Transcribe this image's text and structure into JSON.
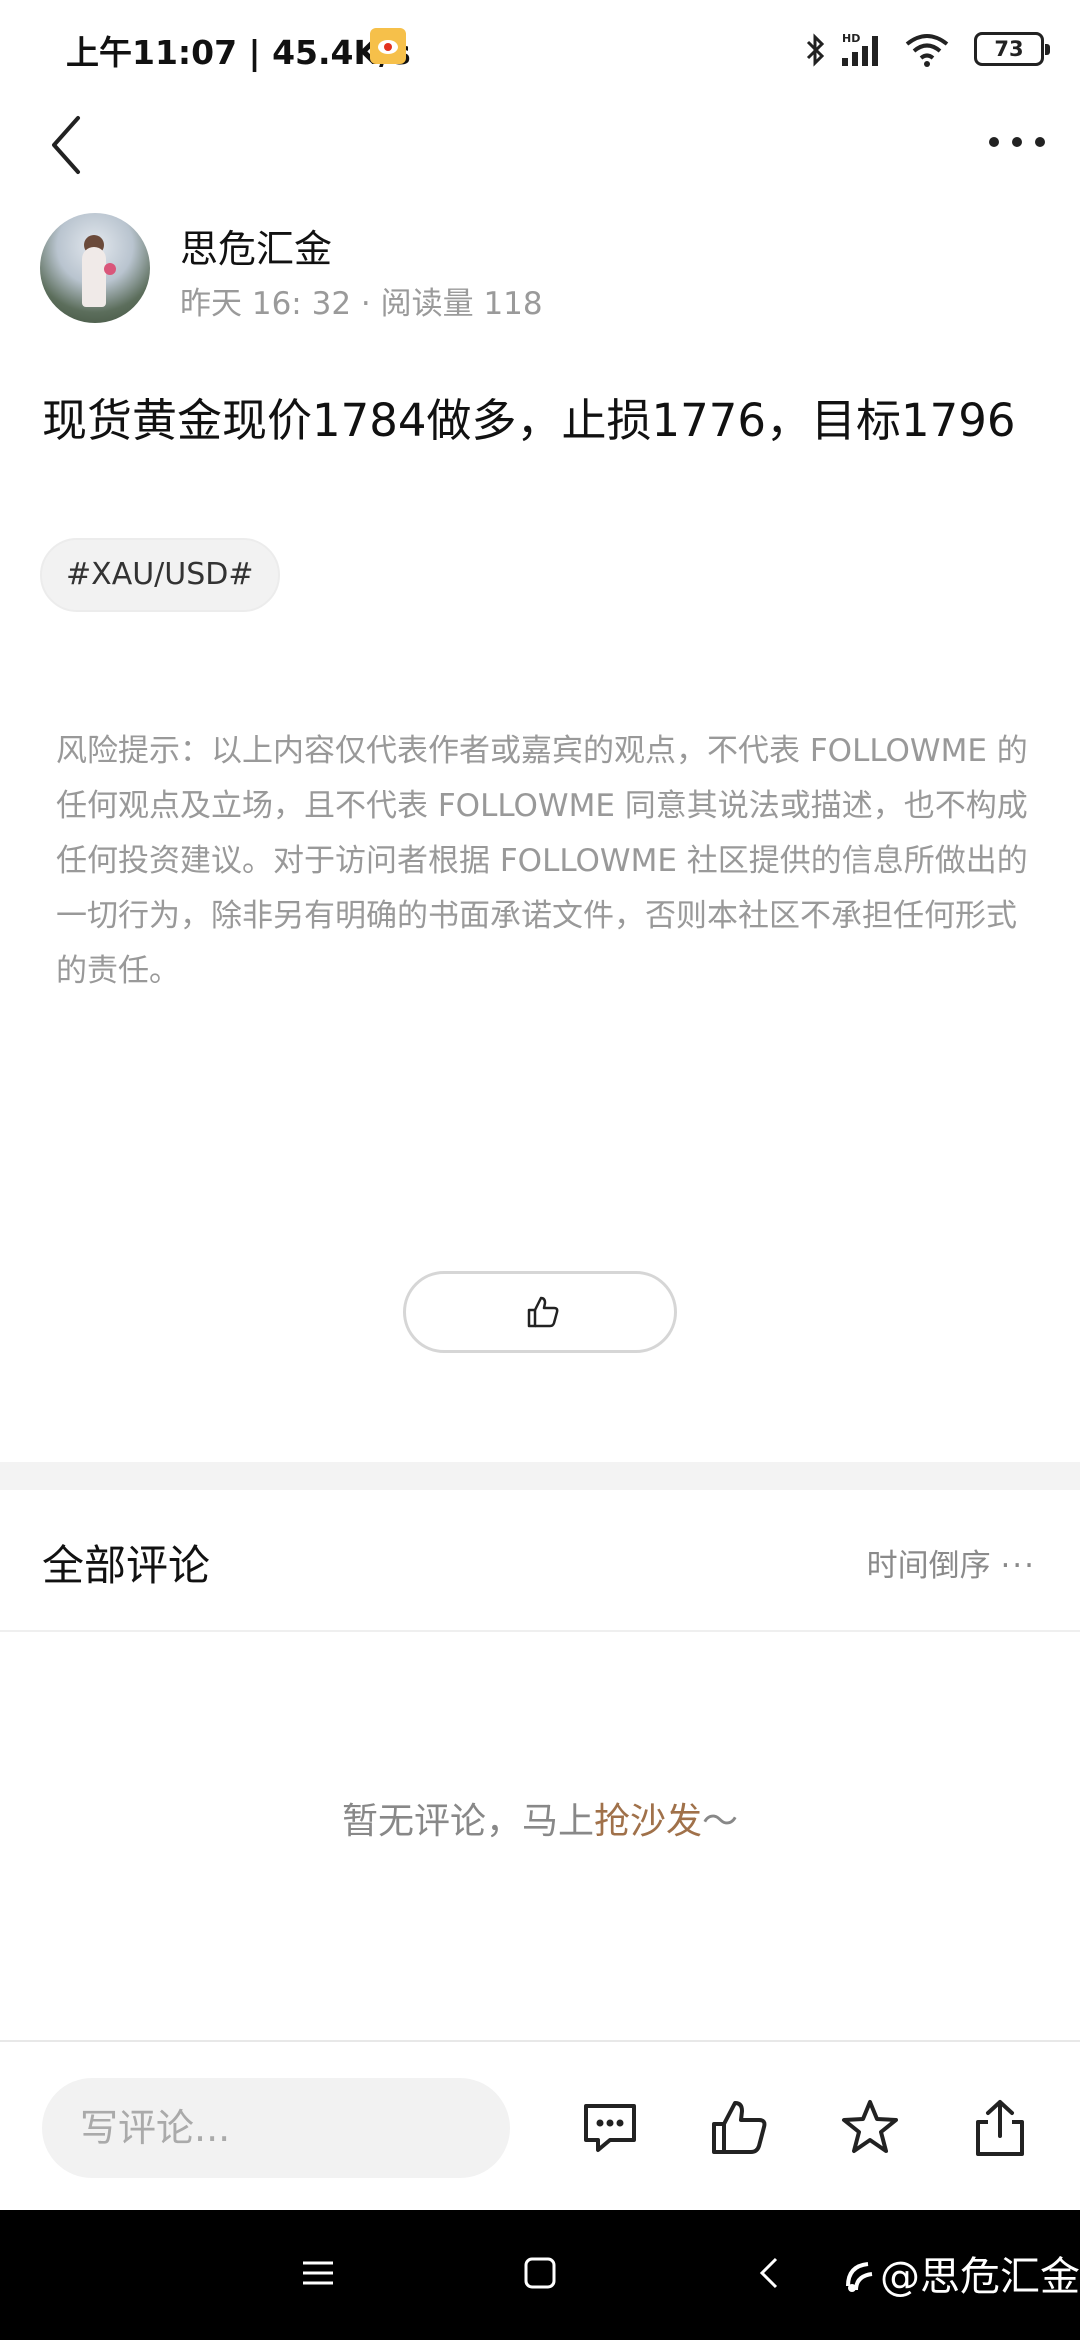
{
  "status_bar": {
    "time_speed": "上午11:07 | 45.4K/s",
    "battery": "73"
  },
  "nav": {
    "back_icon": "chevron-left-icon",
    "more_icon": "more-horizontal-icon"
  },
  "author": {
    "name": "思危汇金",
    "meta": "昨天 16: 32 · 阅读量 118"
  },
  "post": {
    "title": "现货黄金现价1784做多，止损1776，目标1796",
    "topic_tag": "#XAU/USD#",
    "disclaimer": "风险提示：以上内容仅代表作者或嘉宾的观点，不代表 FOLLOWME 的任何观点及立场，且不代表 FOLLOWME 同意其说法或描述，也不构成任何投资建议。对于访问者根据 FOLLOWME 社区提供的信息所做出的一切行为，除非另有明确的书面承诺文件，否则本社区不承担任何形式的责任。"
  },
  "comments": {
    "title": "全部评论",
    "sort_label": "时间倒序",
    "sort_dots": "···",
    "empty_prefix": "暂无评论，马上",
    "empty_cta": "抢沙发",
    "empty_suffix": "～"
  },
  "bottom_bar": {
    "input_placeholder": "写评论..."
  },
  "system_nav": {
    "watermark": "@思危汇金"
  },
  "colors": {
    "accent_link": "#a0714a",
    "muted_text": "#999999",
    "divider_band": "#f3f3f3"
  }
}
